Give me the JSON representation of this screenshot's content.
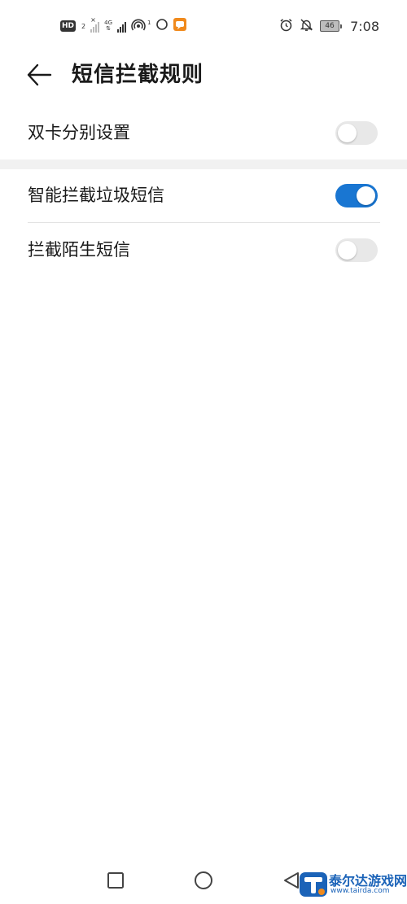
{
  "status_bar": {
    "hd_badge": "HD",
    "sim2": "2",
    "net_4g": "4G",
    "hotspot_count": "1",
    "battery_level": "46",
    "time": "7:08"
  },
  "header": {
    "title": "短信拦截规则"
  },
  "settings": [
    {
      "label": "双卡分别设置",
      "enabled": false
    },
    {
      "label": "智能拦截垃圾短信",
      "enabled": true
    },
    {
      "label": "拦截陌生短信",
      "enabled": false
    }
  ],
  "watermark": {
    "title": "泰尔达游戏网",
    "url": "www.tairda.com"
  },
  "colors": {
    "accent": "#1976d2",
    "toggle_off": "#e8e8e8",
    "watermark": "#1b63b8"
  },
  "icons": {
    "back": "arrow-left-icon",
    "nav_recent": "square-icon",
    "nav_home": "circle-icon",
    "nav_back": "triangle-left-icon"
  }
}
